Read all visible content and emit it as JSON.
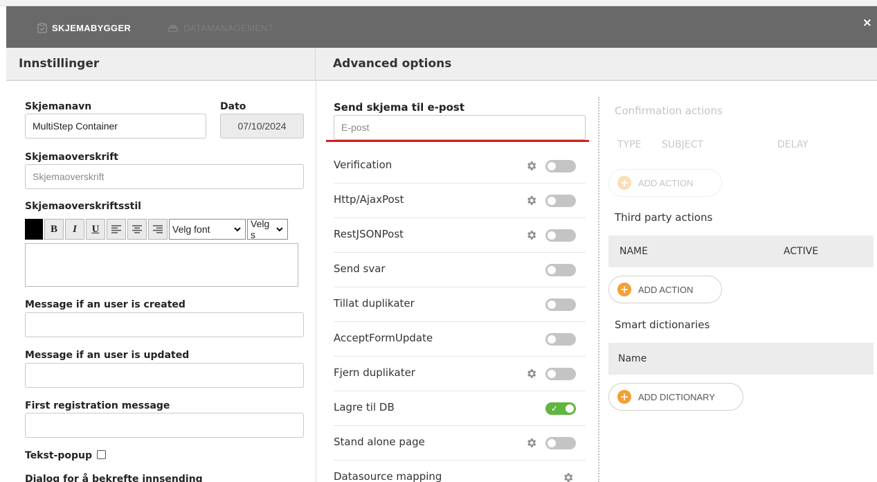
{
  "header": {
    "tabs": [
      {
        "label": "SKJEMABYGGER",
        "icon": "form-check-icon",
        "active": true
      },
      {
        "label": "DATAMANAGEMENT",
        "icon": "database-icon",
        "active": false
      }
    ],
    "close_label": "×"
  },
  "left_panel": {
    "title": "Innstillinger",
    "form_name_label": "Skjemanavn",
    "form_name_value": "MultiStep Container",
    "date_label": "Dato",
    "date_value": "07/10/2024",
    "heading_label": "Skjemaoverskrift",
    "heading_placeholder": "Skjemaoverskrift",
    "heading_style_label": "Skjemaoverskriftsstil",
    "toolbar": {
      "bold": "B",
      "italic": "I",
      "underline": "U",
      "font_select": "Velg font",
      "size_select": "Velg s"
    },
    "user_created_label": "Message if an user is created",
    "user_updated_label": "Message if an user is updated",
    "first_registration_label": "First registration message",
    "text_popup_label": "Tekst-popup",
    "confirm_dialog_label": "Dialog for å bekrefte innsending"
  },
  "advanced": {
    "title": "Advanced options",
    "send_email_label": "Send skjema til e-post",
    "email_placeholder": "E-post",
    "options": [
      {
        "label": "Verification",
        "gear": true,
        "on": false
      },
      {
        "label": "Http/AjaxPost",
        "gear": true,
        "on": false
      },
      {
        "label": "RestJSONPost",
        "gear": true,
        "on": false
      },
      {
        "label": "Send svar",
        "gear": false,
        "on": false
      },
      {
        "label": "Tillat duplikater",
        "gear": false,
        "on": false
      },
      {
        "label": "AcceptFormUpdate",
        "gear": false,
        "on": false
      },
      {
        "label": "Fjern duplikater",
        "gear": true,
        "on": false
      },
      {
        "label": "Lagre til DB",
        "gear": false,
        "on": true
      },
      {
        "label": "Stand alone page",
        "gear": true,
        "on": false
      },
      {
        "label": "Datasource mapping",
        "gear": true,
        "on": null
      }
    ]
  },
  "actions": {
    "confirmation_title": "Confirmation actions",
    "confirmation_columns": [
      "TYPE",
      "SUBJECT",
      "DELAY"
    ],
    "add_action_label": "ADD ACTION",
    "third_party_title": "Third party actions",
    "third_party_columns": [
      "NAME",
      "ACTIVE"
    ],
    "smart_dictionaries_title": "Smart dictionaries",
    "dictionary_columns": [
      "Name"
    ],
    "add_dictionary_label": "ADD DICTIONARY"
  },
  "colors": {
    "header_bg": "#696969",
    "toggle_on": "#61b541",
    "toggle_off": "#c4c4c4",
    "add_button": "#f4a035",
    "email_underline": "#d21f1f"
  }
}
